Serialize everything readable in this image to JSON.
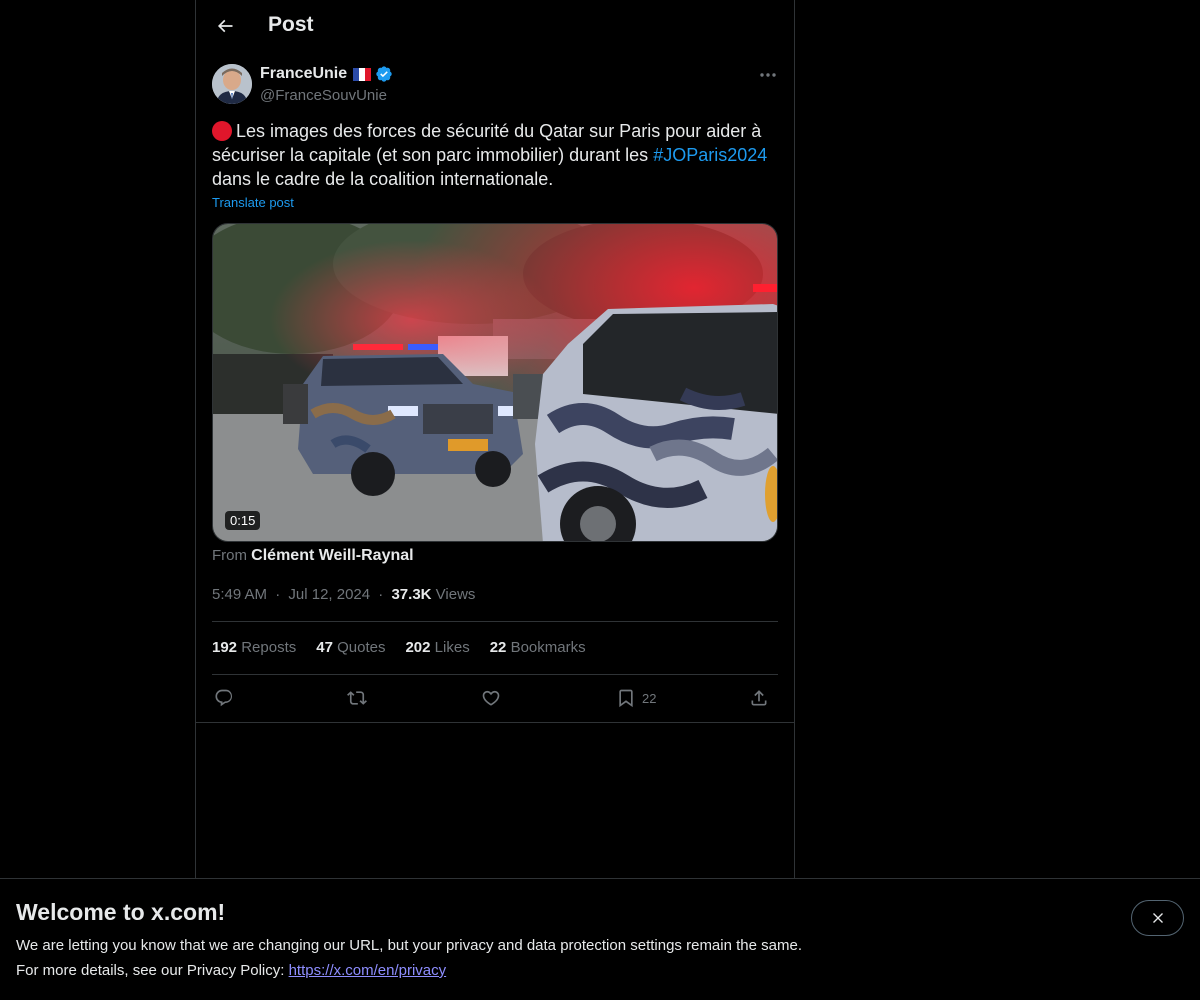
{
  "header": {
    "title": "Post"
  },
  "post": {
    "author_name": "FranceUnie",
    "author_handle": "@FranceSouvUnie",
    "text_part1": "Les images des forces de sécurité du Qatar sur Paris pour aider à sécuriser la capitale (et son parc immobilier) durant les ",
    "hashtag": "#JOParis2024",
    "text_part2": " dans le cadre de la coalition internationale.",
    "translate_label": "Translate post",
    "media_duration": "0:15",
    "from_label": "From",
    "from_source": "Clément Weill-Raynal",
    "time": "5:49 AM",
    "date": "Jul 12, 2024",
    "dot": "·",
    "views_count": "37.3K",
    "views_label": "Views"
  },
  "stats": [
    {
      "num": "192",
      "label": "Reposts"
    },
    {
      "num": "47",
      "label": "Quotes"
    },
    {
      "num": "202",
      "label": "Likes"
    },
    {
      "num": "22",
      "label": "Bookmarks"
    }
  ],
  "actions": {
    "reply_icon": "reply-icon",
    "repost_icon": "repost-icon",
    "like_icon": "heart-icon",
    "bookmark_icon": "bookmark-icon",
    "bookmark_count": "22",
    "share_icon": "share-icon"
  },
  "banner": {
    "title": "Welcome to x.com!",
    "line1": "We are letting you know that we are changing our URL, but your privacy and data protection settings remain the same.",
    "line2_prefix": "For more details, see our Privacy Policy: ",
    "link": "https://x.com/en/privacy"
  },
  "colors": {
    "accent": "#1d9bf0",
    "background": "#000000",
    "text": "#e7e9ea",
    "muted": "#71767b",
    "border": "#2f3336"
  }
}
